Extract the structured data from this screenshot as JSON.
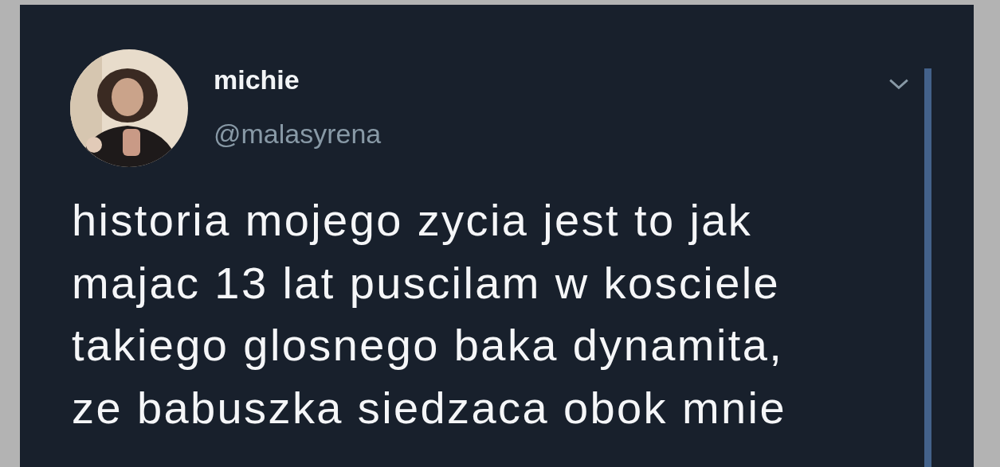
{
  "tweet": {
    "display_name": "michie",
    "handle": "@malasyrena",
    "text_lines": [
      "historia mojego zycia jest to jak",
      "majac 13 lat puscilam w kosciele",
      "takiego glosnego baka dynamita,",
      "ze babuszka siedzaca obok mnie"
    ]
  }
}
